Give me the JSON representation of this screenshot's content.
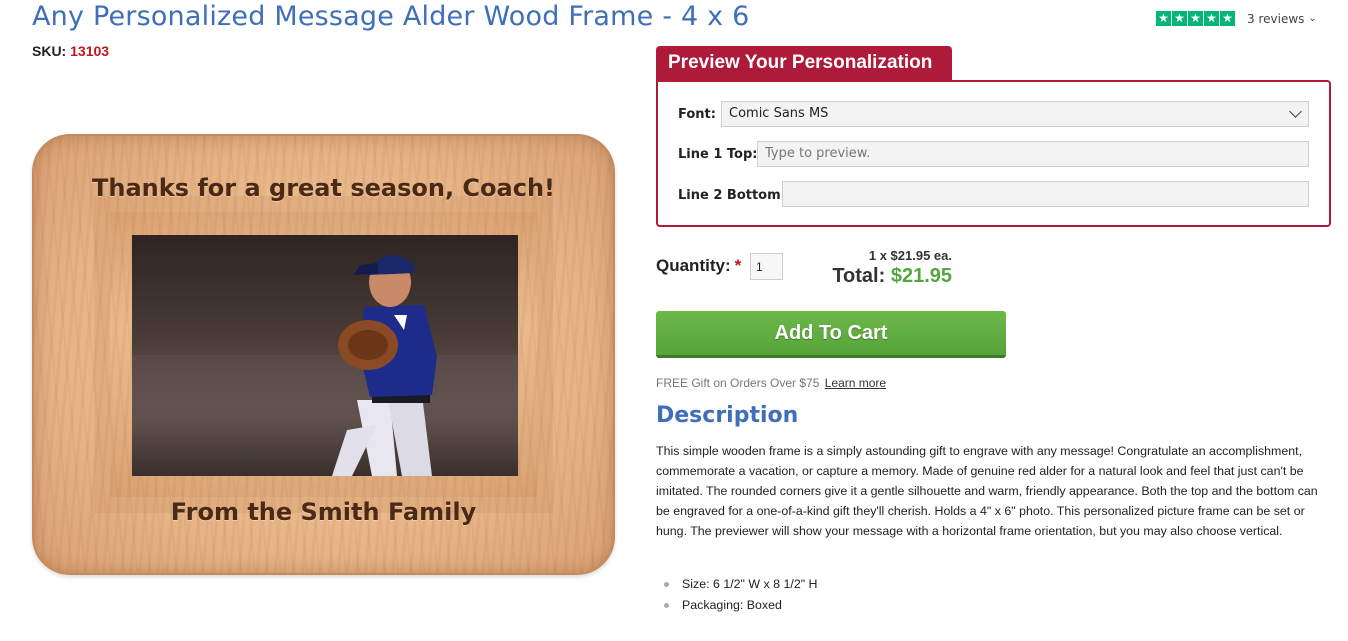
{
  "product": {
    "title": "Any Personalized Message Alder Wood Frame - 4 x 6",
    "sku_label": "SKU:",
    "sku_value": "13103"
  },
  "rating": {
    "stars": 5,
    "star_color": "#00b67a",
    "reviews_text": "3 reviews"
  },
  "frame_image": {
    "top_engraving": "Thanks for a great season, Coach!",
    "bottom_engraving": "From the Smith Family"
  },
  "preview": {
    "heading": "Preview Your Personalization",
    "accent_color": "#ad1a3a",
    "font_label": "Font:",
    "font_value": "Comic Sans MS",
    "line1_label": "Line 1 Top:",
    "line1_placeholder": "Type to preview.",
    "line2_label": "Line 2 Bottom:",
    "line2_value": ""
  },
  "purchase": {
    "quantity_label": "Quantity:",
    "required_mark": "*",
    "quantity_value": "1",
    "each_text": "1 x $21.95 ea.",
    "total_label": "Total:",
    "total_value": "$21.95",
    "add_to_cart": "Add To Cart",
    "button_color": "#5cad3f",
    "gift_text": "FREE Gift on Orders Over $75",
    "learn_more": "Learn more"
  },
  "description": {
    "heading": "Description",
    "body": "This simple wooden frame is a simply astounding gift to engrave with any message! Congratulate an accomplishment, commemorate a vacation, or capture a memory.  Made of genuine red alder for a natural look and feel that just can't be imitated. The rounded corners give it a gentle silhouette and warm, friendly appearance. Both the top and the bottom can be engraved for a one-of-a-kind gift they'll cherish. Holds a 4\" x 6\" photo. This personalized picture frame can be set or hung. The previewer will show your message with a horizontal frame orientation, but you may also choose vertical.",
    "specs": [
      "Size: 6 1/2\" W x 8 1/2\" H",
      "Packaging: Boxed"
    ]
  }
}
